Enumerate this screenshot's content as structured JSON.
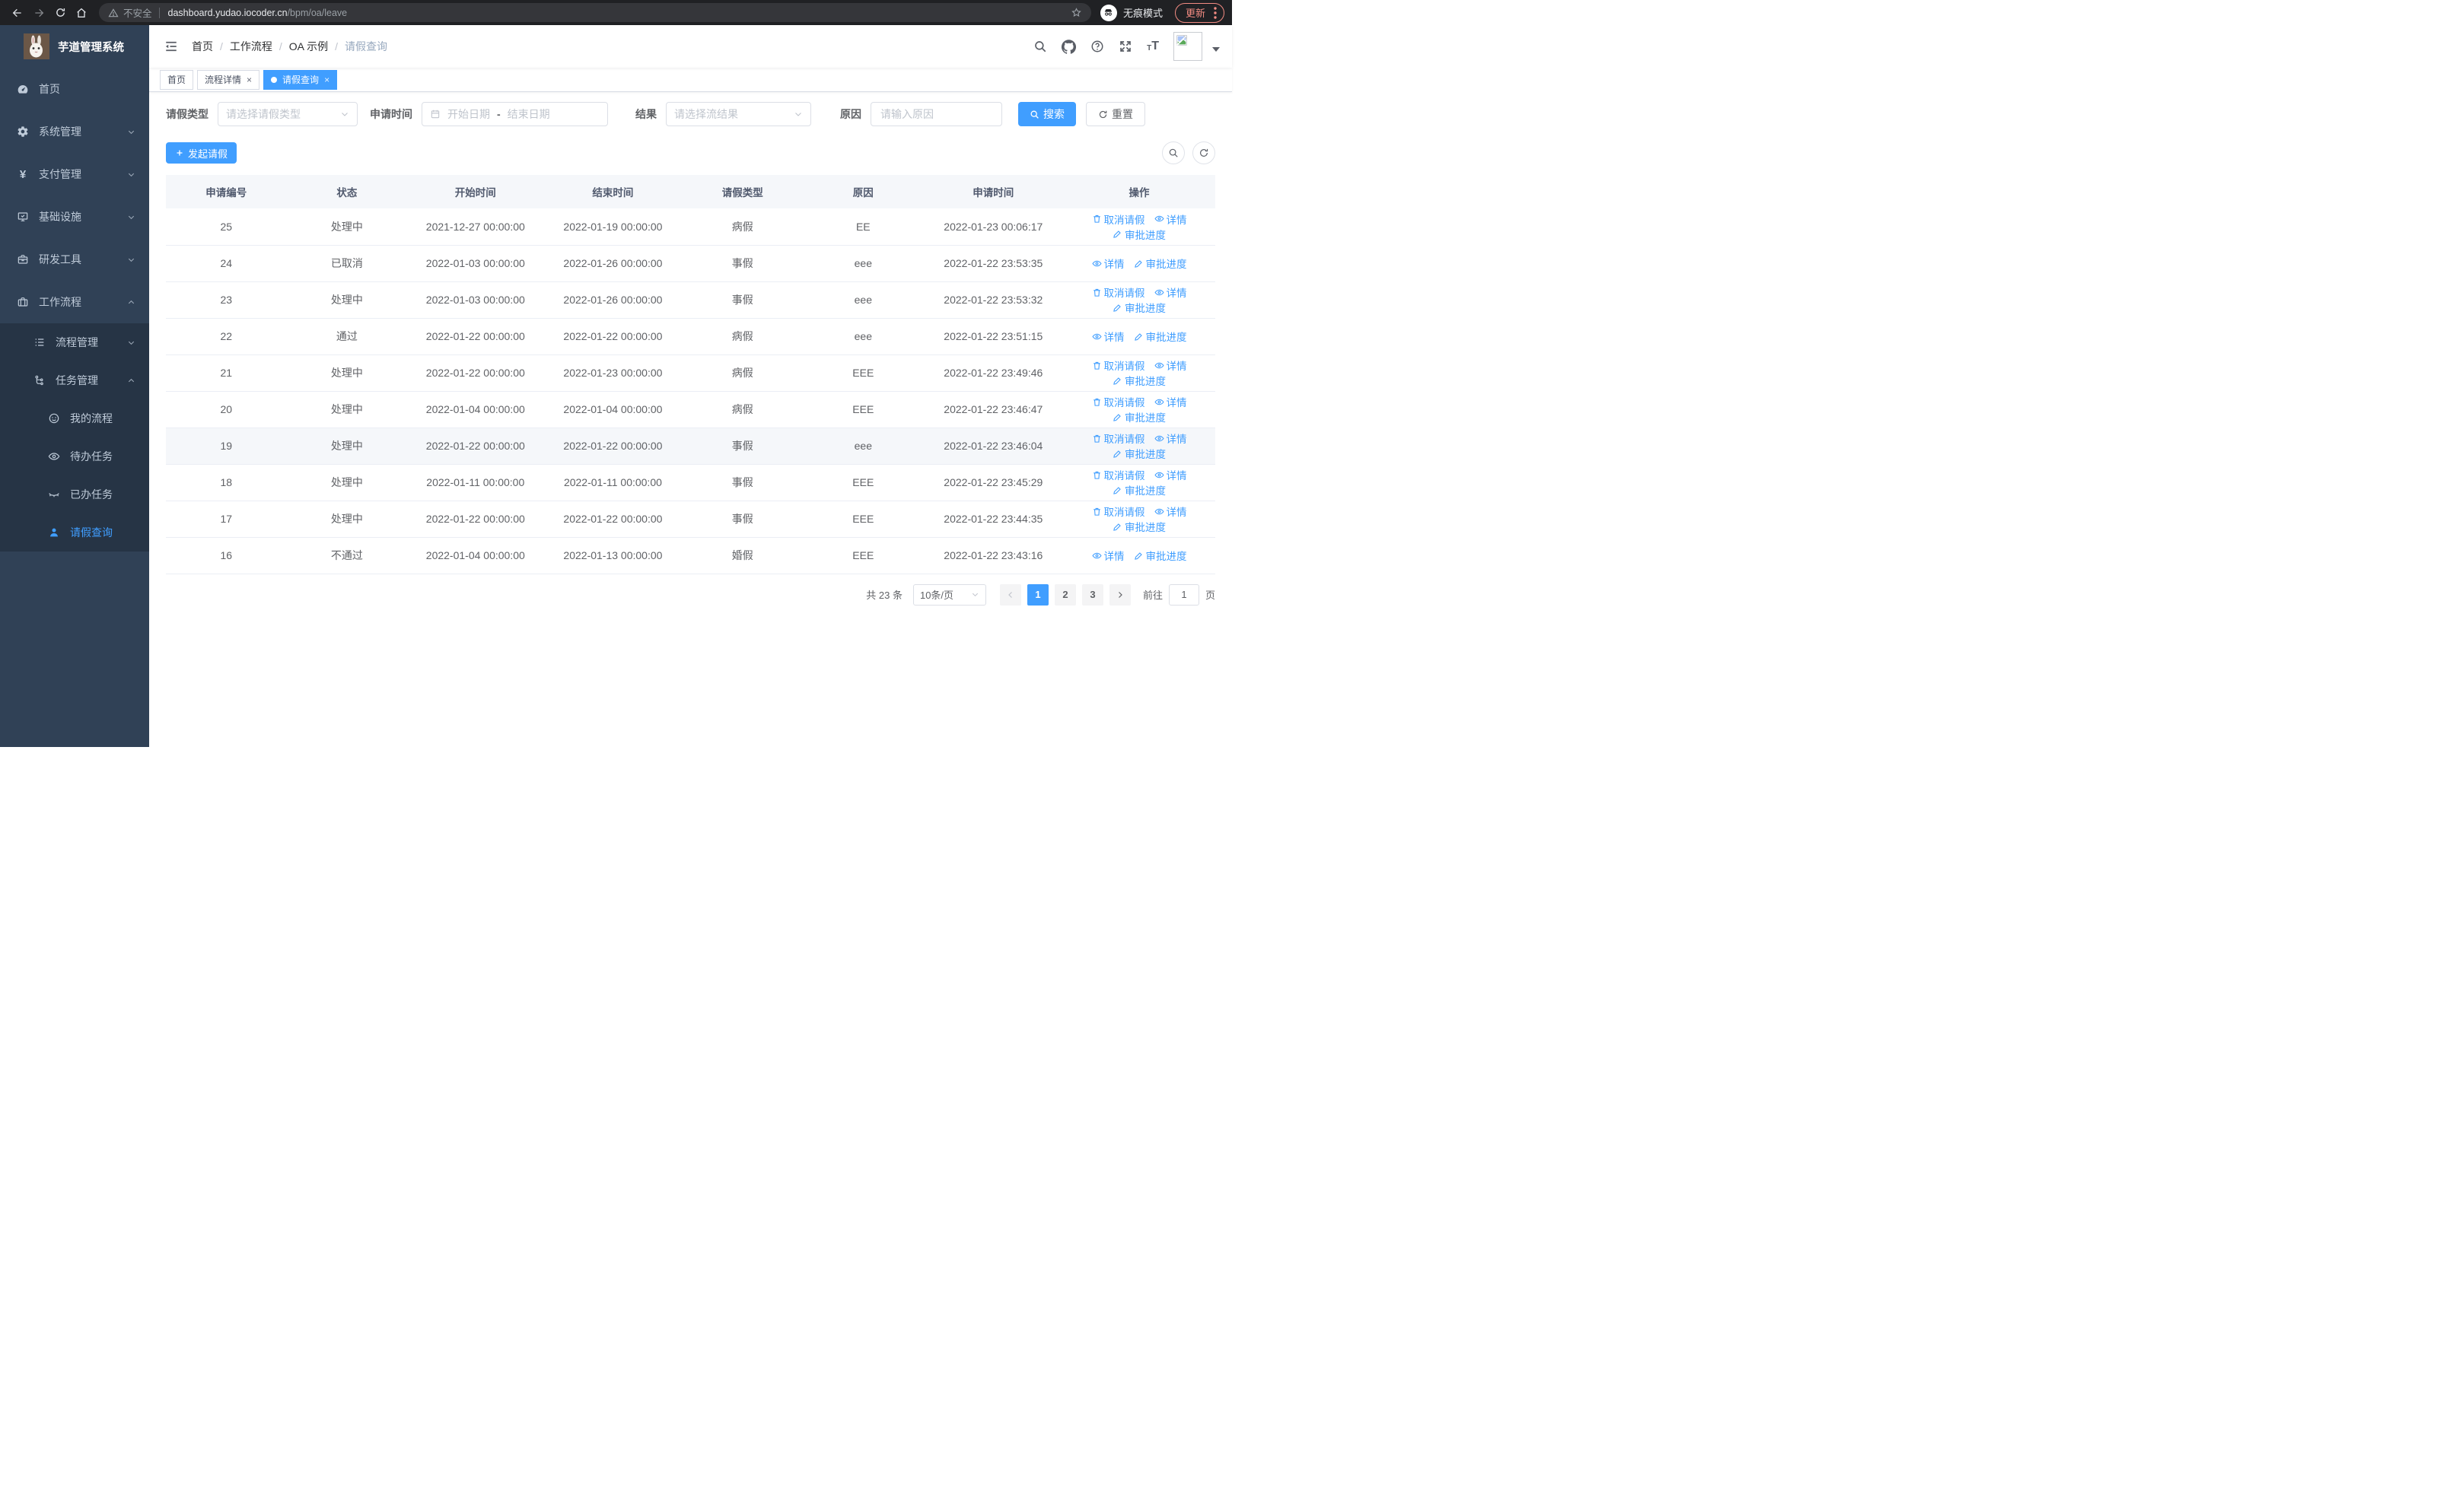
{
  "browser": {
    "security_label": "不安全",
    "url_host": "dashboard.yudao.iocoder.cn",
    "url_path": "/bpm/oa/leave",
    "incognito_label": "无痕模式",
    "update_label": "更新"
  },
  "sidebar": {
    "app_title": "芋道管理系统",
    "items": [
      {
        "label": "首页"
      },
      {
        "label": "系统管理"
      },
      {
        "label": "支付管理"
      },
      {
        "label": "基础设施"
      },
      {
        "label": "研发工具"
      },
      {
        "label": "工作流程"
      },
      {
        "label": "流程管理"
      },
      {
        "label": "任务管理"
      },
      {
        "label": "我的流程"
      },
      {
        "label": "待办任务"
      },
      {
        "label": "已办任务"
      },
      {
        "label": "请假查询"
      }
    ]
  },
  "breadcrumb": [
    "首页",
    "工作流程",
    "OA 示例",
    "请假查询"
  ],
  "tabs": [
    {
      "label": "首页"
    },
    {
      "label": "流程详情"
    },
    {
      "label": "请假查询"
    }
  ],
  "filters": {
    "type_label": "请假类型",
    "type_placeholder": "请选择请假类型",
    "time_label": "申请时间",
    "date_start_placeholder": "开始日期",
    "date_separator": "-",
    "date_end_placeholder": "结束日期",
    "result_label": "结果",
    "result_placeholder": "请选择流结果",
    "reason_label": "原因",
    "reason_placeholder": "请输入原因",
    "search_label": "搜索",
    "reset_label": "重置"
  },
  "toolbar": {
    "create_label": "发起请假"
  },
  "table": {
    "columns": [
      "申请编号",
      "状态",
      "开始时间",
      "结束时间",
      "请假类型",
      "原因",
      "申请时间",
      "操作"
    ],
    "action_labels": {
      "cancel": "取消请假",
      "detail": "详情",
      "progress": "审批进度"
    },
    "rows": [
      {
        "id": "25",
        "status": "处理中",
        "start": "2021-12-27 00:00:00",
        "end": "2022-01-19 00:00:00",
        "type": "病假",
        "reason": "EE",
        "apply_time": "2022-01-23 00:06:17",
        "actions": [
          "cancel",
          "detail",
          "progress"
        ],
        "highlighted": false
      },
      {
        "id": "24",
        "status": "已取消",
        "start": "2022-01-03 00:00:00",
        "end": "2022-01-26 00:00:00",
        "type": "事假",
        "reason": "eee",
        "apply_time": "2022-01-22 23:53:35",
        "actions": [
          "detail",
          "progress"
        ],
        "highlighted": false
      },
      {
        "id": "23",
        "status": "处理中",
        "start": "2022-01-03 00:00:00",
        "end": "2022-01-26 00:00:00",
        "type": "事假",
        "reason": "eee",
        "apply_time": "2022-01-22 23:53:32",
        "actions": [
          "cancel",
          "detail",
          "progress"
        ],
        "highlighted": false
      },
      {
        "id": "22",
        "status": "通过",
        "start": "2022-01-22 00:00:00",
        "end": "2022-01-22 00:00:00",
        "type": "病假",
        "reason": "eee",
        "apply_time": "2022-01-22 23:51:15",
        "actions": [
          "detail",
          "progress"
        ],
        "highlighted": false
      },
      {
        "id": "21",
        "status": "处理中",
        "start": "2022-01-22 00:00:00",
        "end": "2022-01-23 00:00:00",
        "type": "病假",
        "reason": "EEE",
        "apply_time": "2022-01-22 23:49:46",
        "actions": [
          "cancel",
          "detail",
          "progress"
        ],
        "highlighted": false
      },
      {
        "id": "20",
        "status": "处理中",
        "start": "2022-01-04 00:00:00",
        "end": "2022-01-04 00:00:00",
        "type": "病假",
        "reason": "EEE",
        "apply_time": "2022-01-22 23:46:47",
        "actions": [
          "cancel",
          "detail",
          "progress"
        ],
        "highlighted": false
      },
      {
        "id": "19",
        "status": "处理中",
        "start": "2022-01-22 00:00:00",
        "end": "2022-01-22 00:00:00",
        "type": "事假",
        "reason": "eee",
        "apply_time": "2022-01-22 23:46:04",
        "actions": [
          "cancel",
          "detail",
          "progress"
        ],
        "highlighted": true
      },
      {
        "id": "18",
        "status": "处理中",
        "start": "2022-01-11 00:00:00",
        "end": "2022-01-11 00:00:00",
        "type": "事假",
        "reason": "EEE",
        "apply_time": "2022-01-22 23:45:29",
        "actions": [
          "cancel",
          "detail",
          "progress"
        ],
        "highlighted": false
      },
      {
        "id": "17",
        "status": "处理中",
        "start": "2022-01-22 00:00:00",
        "end": "2022-01-22 00:00:00",
        "type": "事假",
        "reason": "EEE",
        "apply_time": "2022-01-22 23:44:35",
        "actions": [
          "cancel",
          "detail",
          "progress"
        ],
        "highlighted": false
      },
      {
        "id": "16",
        "status": "不通过",
        "start": "2022-01-04 00:00:00",
        "end": "2022-01-13 00:00:00",
        "type": "婚假",
        "reason": "EEE",
        "apply_time": "2022-01-22 23:43:16",
        "actions": [
          "detail",
          "progress"
        ],
        "highlighted": false
      }
    ]
  },
  "pagination": {
    "total_label": "共 23 条",
    "page_size": "10条/页",
    "pages": [
      "1",
      "2",
      "3"
    ],
    "goto_label": "前往",
    "goto_value": "1",
    "page_unit": "页"
  }
}
